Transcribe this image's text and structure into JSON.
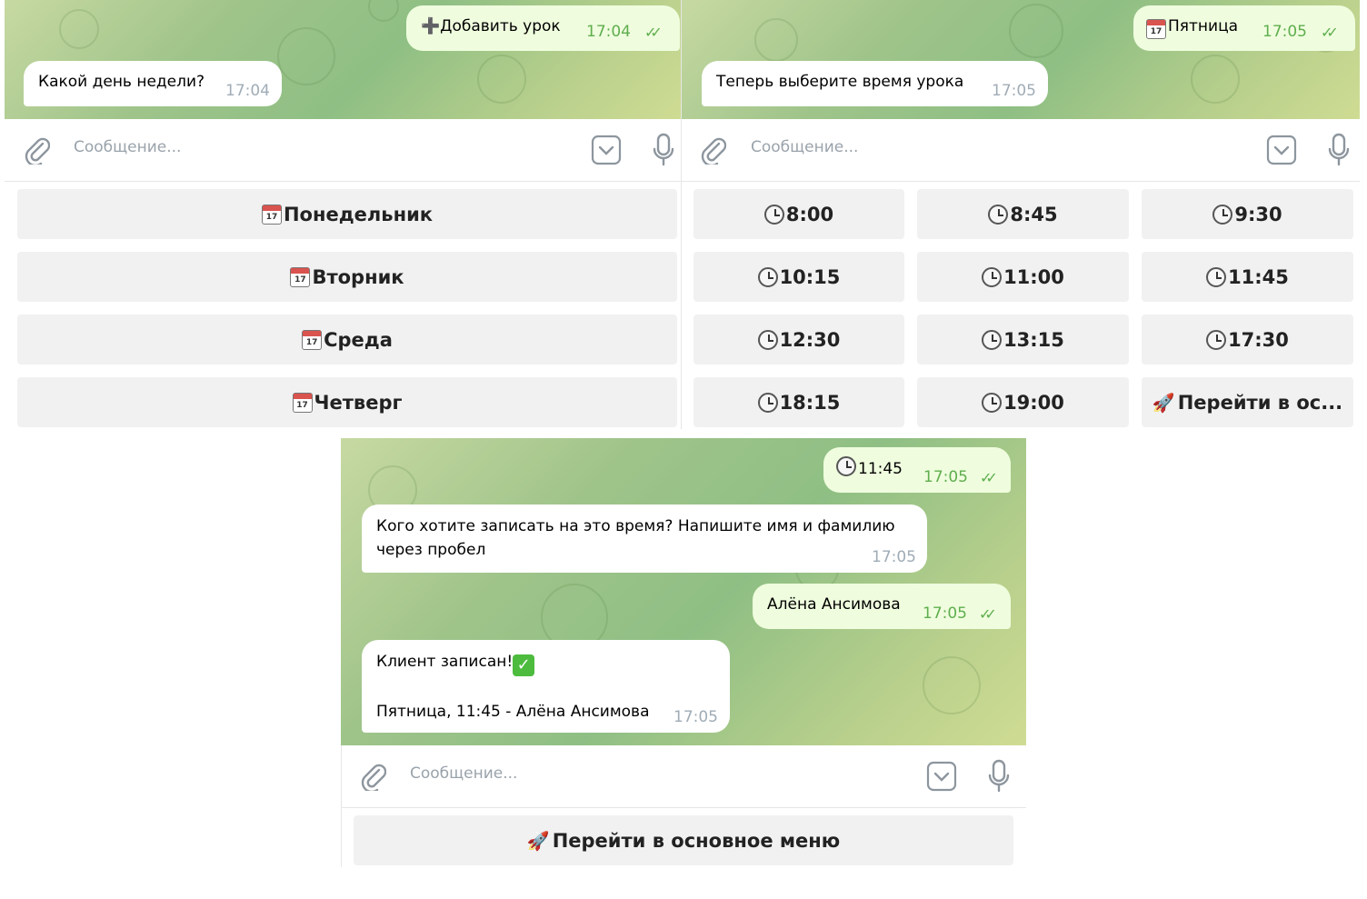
{
  "input_placeholder": "Сообщение...",
  "panel1": {
    "out_message": {
      "text": "➕Добавить урок",
      "time": "17:04"
    },
    "in_message": {
      "text": "Какой день недели?",
      "time": "17:04"
    },
    "keyboard": [
      "Понедельник",
      "Вторник",
      "Среда",
      "Четверг"
    ]
  },
  "panel2": {
    "out_message": {
      "text": "Пятница",
      "time": "17:05"
    },
    "in_message": {
      "text": "Теперь выберите время урока",
      "time": "17:05"
    },
    "keyboard": [
      "8:00",
      "8:45",
      "9:30",
      "10:15",
      "11:00",
      "11:45",
      "12:30",
      "13:15",
      "17:30",
      "18:15",
      "19:00"
    ],
    "menu_button": "Перейти в ос..."
  },
  "panel3": {
    "out_time_message": {
      "text": "11:45",
      "time": "17:05"
    },
    "in_question": {
      "line1": "Кого хотите записать на это время? Напишите имя и фамилию",
      "line2": "через пробел",
      "time": "17:05"
    },
    "out_name": {
      "text": "Алёна Ансимова",
      "time": "17:05"
    },
    "in_result": {
      "line1": "Клиент записан!",
      "line2": "Пятница, 11:45 - Алёна Ансимова",
      "time": "17:05"
    },
    "menu_button": "Перейти в основное меню"
  },
  "icons": {
    "calendar_day": "17"
  }
}
